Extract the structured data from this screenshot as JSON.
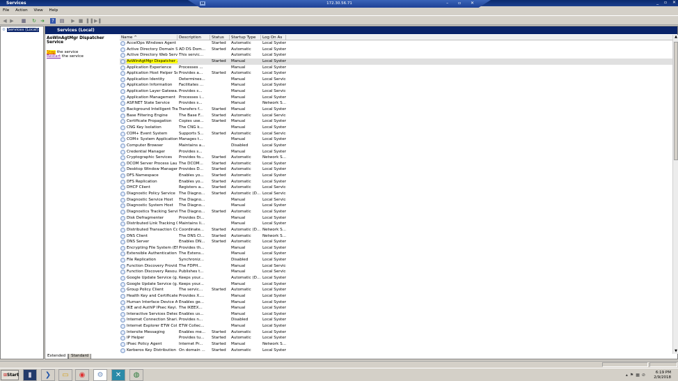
{
  "window": {
    "title": "Services",
    "controls": "_ ▫ ✕"
  },
  "rdp": {
    "host": "172.30.56.71",
    "pin": "⧓",
    "controls": "– ▫ ✕"
  },
  "menu": [
    "File",
    "Action",
    "View",
    "Help"
  ],
  "tree": {
    "root": "Services (Local)"
  },
  "panel": {
    "title": "Services (Local)"
  },
  "details": {
    "service_name": "AoWinAgtMgr Dispatcher Service",
    "stop_link": "Stop",
    "stop_suffix": " the service",
    "restart_link": "Restart",
    "restart_suffix": " the service"
  },
  "columns": [
    "Name",
    "Description",
    "Status",
    "Startup Type",
    "Log On As"
  ],
  "sort_indicator": "^",
  "selected_index": 3,
  "rows": [
    [
      "AccelOps Windows Agent",
      "",
      "Started",
      "Automatic",
      "Local System"
    ],
    [
      "Active Directory Domain S...",
      "AD DS Dom...",
      "Started",
      "Automatic",
      "Local System"
    ],
    [
      "Active Directory Web Serv...",
      "This servic...",
      "",
      "Automatic",
      "Local System"
    ],
    [
      "AoWinAgtMgr Dispatcher ...",
      "",
      "Started",
      "Manual",
      "Local System"
    ],
    [
      "Application Experience",
      "Processes ...",
      "",
      "Manual",
      "Local System"
    ],
    [
      "Application Host Helper Se...",
      "Provides a...",
      "Started",
      "Automatic",
      "Local System"
    ],
    [
      "Application Identity",
      "Determines...",
      "",
      "Manual",
      "Local Service"
    ],
    [
      "Application Information",
      "Facilitates ...",
      "",
      "Manual",
      "Local System"
    ],
    [
      "Application Layer Gatewa...",
      "Provides s...",
      "",
      "Manual",
      "Local Service"
    ],
    [
      "Application Management",
      "Processes i...",
      "",
      "Manual",
      "Local System"
    ],
    [
      "ASP.NET State Service",
      "Provides s...",
      "",
      "Manual",
      "Network S..."
    ],
    [
      "Background Intelligent Tra...",
      "Transfers f...",
      "Started",
      "Manual",
      "Local System"
    ],
    [
      "Base Filtering Engine",
      "The Base F...",
      "Started",
      "Automatic",
      "Local Service"
    ],
    [
      "Certificate Propagation",
      "Copies use...",
      "Started",
      "Manual",
      "Local System"
    ],
    [
      "CNG Key Isolation",
      "The CNG k...",
      "",
      "Manual",
      "Local System"
    ],
    [
      "COM+ Event System",
      "Supports S...",
      "Started",
      "Automatic",
      "Local Service"
    ],
    [
      "COM+ System Application",
      "Manages t...",
      "",
      "Manual",
      "Local System"
    ],
    [
      "Computer Browser",
      "Maintains a...",
      "",
      "Disabled",
      "Local System"
    ],
    [
      "Credential Manager",
      "Provides s...",
      "",
      "Manual",
      "Local System"
    ],
    [
      "Cryptographic Services",
      "Provides fo...",
      "Started",
      "Automatic",
      "Network S..."
    ],
    [
      "DCOM Server Process Lau...",
      "The DCOM...",
      "Started",
      "Automatic",
      "Local System"
    ],
    [
      "Desktop Window Manager...",
      "Provides D...",
      "Started",
      "Automatic",
      "Local System"
    ],
    [
      "DFS Namespace",
      "Enables yo...",
      "Started",
      "Automatic",
      "Local System"
    ],
    [
      "DFS Replication",
      "Enables yo...",
      "Started",
      "Automatic",
      "Local System"
    ],
    [
      "DHCP Client",
      "Registers a...",
      "Started",
      "Automatic",
      "Local Service"
    ],
    [
      "Diagnostic Policy Service",
      "The Diagno...",
      "Started",
      "Automatic (D...",
      "Local Service"
    ],
    [
      "Diagnostic Service Host",
      "The Diagno...",
      "",
      "Manual",
      "Local Service"
    ],
    [
      "Diagnostic System Host",
      "The Diagno...",
      "",
      "Manual",
      "Local System"
    ],
    [
      "Diagnostics Tracking Service",
      "The Diagno...",
      "Started",
      "Automatic",
      "Local System"
    ],
    [
      "Disk Defragmenter",
      "Provides Di...",
      "",
      "Manual",
      "Local System"
    ],
    [
      "Distributed Link Tracking C...",
      "Maintains li...",
      "",
      "Manual",
      "Local System"
    ],
    [
      "Distributed Transaction Co...",
      "Coordinate...",
      "Started",
      "Automatic (D...",
      "Network S..."
    ],
    [
      "DNS Client",
      "The DNS Cl...",
      "Started",
      "Automatic",
      "Network S..."
    ],
    [
      "DNS Server",
      "Enables DN...",
      "Started",
      "Automatic",
      "Local System"
    ],
    [
      "Encrypting File System (EFS)",
      "Provides th...",
      "",
      "Manual",
      "Local System"
    ],
    [
      "Extensible Authentication ...",
      "The Extens...",
      "",
      "Manual",
      "Local System"
    ],
    [
      "File Replication",
      "Synchroniz...",
      "",
      "Disabled",
      "Local System"
    ],
    [
      "Function Discovery Provid...",
      "The FDPH...",
      "",
      "Manual",
      "Local Service"
    ],
    [
      "Function Discovery Resou...",
      "Publishes t...",
      "",
      "Manual",
      "Local Service"
    ],
    [
      "Google Update Service (g...",
      "Keeps your...",
      "",
      "Automatic (D...",
      "Local System"
    ],
    [
      "Google Update Service (g...",
      "Keeps your...",
      "",
      "Manual",
      "Local System"
    ],
    [
      "Group Policy Client",
      "The servic...",
      "Started",
      "Automatic",
      "Local System"
    ],
    [
      "Health Key and Certificate...",
      "Provides X....",
      "",
      "Manual",
      "Local System"
    ],
    [
      "Human Interface Device A...",
      "Enables ge...",
      "",
      "Manual",
      "Local System"
    ],
    [
      "IKE and AuthIP IPsec Keyi...",
      "The IKEEX...",
      "",
      "Manual",
      "Local System"
    ],
    [
      "Interactive Services Detec...",
      "Enables us...",
      "",
      "Manual",
      "Local System"
    ],
    [
      "Internet Connection Shari...",
      "Provides n...",
      "",
      "Disabled",
      "Local System"
    ],
    [
      "Internet Explorer ETW Col...",
      "ETW Collec...",
      "",
      "Manual",
      "Local System"
    ],
    [
      "Intersite Messaging",
      "Enables me...",
      "Started",
      "Automatic",
      "Local System"
    ],
    [
      "IP Helper",
      "Provides tu...",
      "Started",
      "Automatic",
      "Local System"
    ],
    [
      "IPsec Policy Agent",
      "Internet Pr...",
      "Started",
      "Manual",
      "Network S..."
    ],
    [
      "Kerberos Key Distribution ...",
      "On domain ...",
      "Started",
      "Automatic",
      "Local System"
    ]
  ],
  "tabs": [
    "Extended",
    "Standard"
  ],
  "taskbar": {
    "start": "Start",
    "time": "6:19 PM",
    "date": "2/9/2018"
  }
}
